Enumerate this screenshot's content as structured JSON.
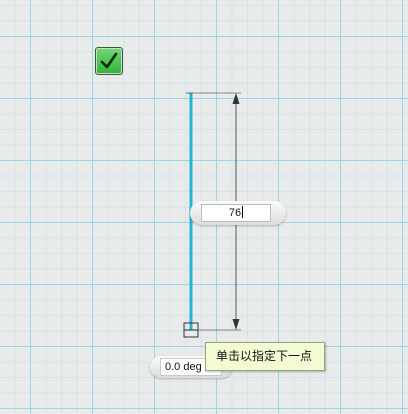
{
  "confirm": {
    "icon": "checkmark-icon",
    "color": "#3dc24a"
  },
  "dimension": {
    "length_value": "76"
  },
  "angle": {
    "value": "0.0 deg"
  },
  "tooltip": {
    "text": "单击以指定下一点"
  },
  "colors": {
    "line": "#26b3d6",
    "dimension_line": "#555555"
  }
}
